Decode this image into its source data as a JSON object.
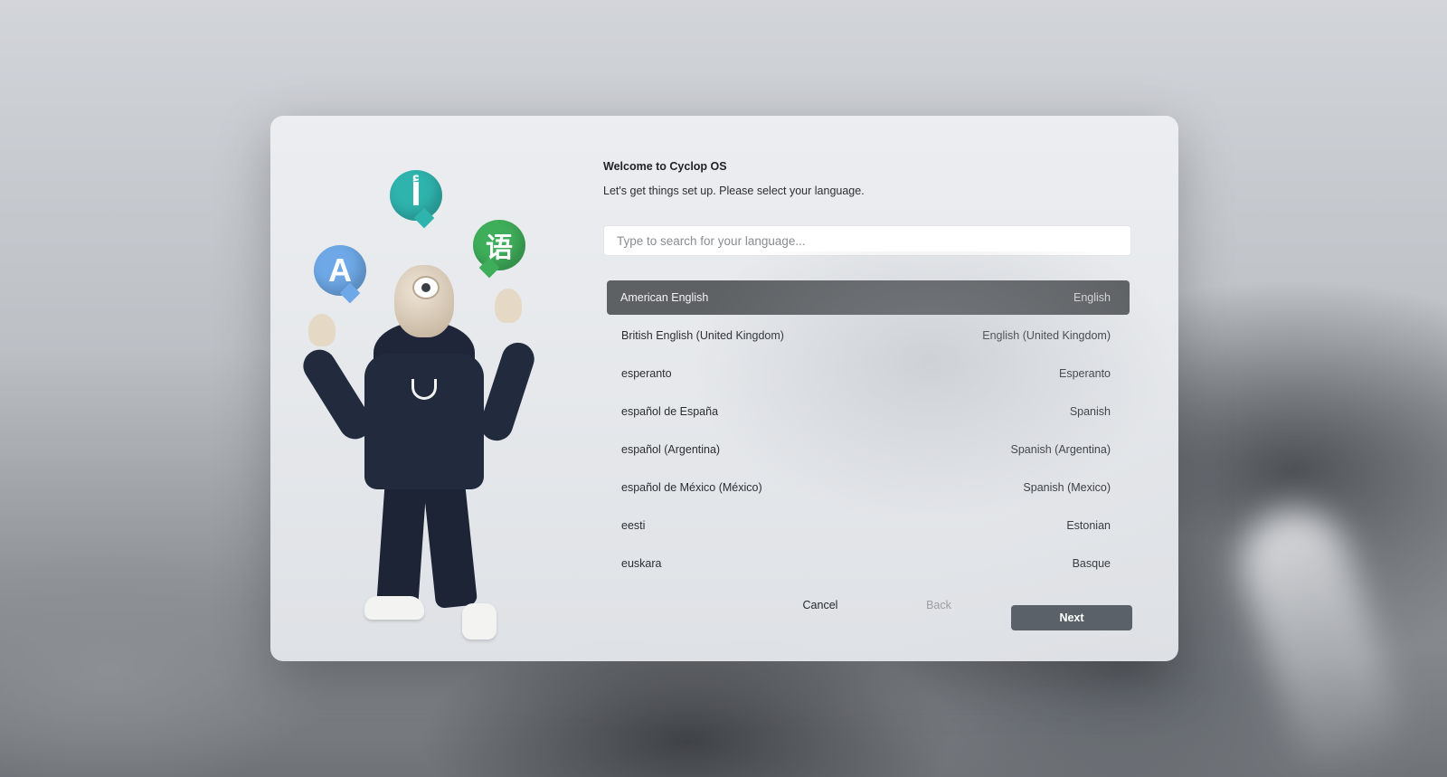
{
  "dialog": {
    "title": "Welcome to Cyclop OS",
    "subtitle": "Let's get things set up. Please select your language.",
    "search_placeholder": "Type to search for your language..."
  },
  "illustration": {
    "bubble_a": "A",
    "bubble_i": "أ",
    "bubble_zh": "语"
  },
  "languages": [
    {
      "native": "American English",
      "english": "English",
      "selected": true
    },
    {
      "native": "British English (United Kingdom)",
      "english": "English (United Kingdom)",
      "selected": false
    },
    {
      "native": "esperanto",
      "english": "Esperanto",
      "selected": false
    },
    {
      "native": "español de España",
      "english": "Spanish",
      "selected": false
    },
    {
      "native": "español (Argentina)",
      "english": "Spanish (Argentina)",
      "selected": false
    },
    {
      "native": "español de México (México)",
      "english": "Spanish (Mexico)",
      "selected": false
    },
    {
      "native": "eesti",
      "english": "Estonian",
      "selected": false
    },
    {
      "native": "euskara",
      "english": "Basque",
      "selected": false
    }
  ],
  "buttons": {
    "cancel": "Cancel",
    "back": "Back",
    "next": "Next"
  },
  "colors": {
    "selected_row": "#5e6164",
    "next_button": "#5b6168"
  }
}
